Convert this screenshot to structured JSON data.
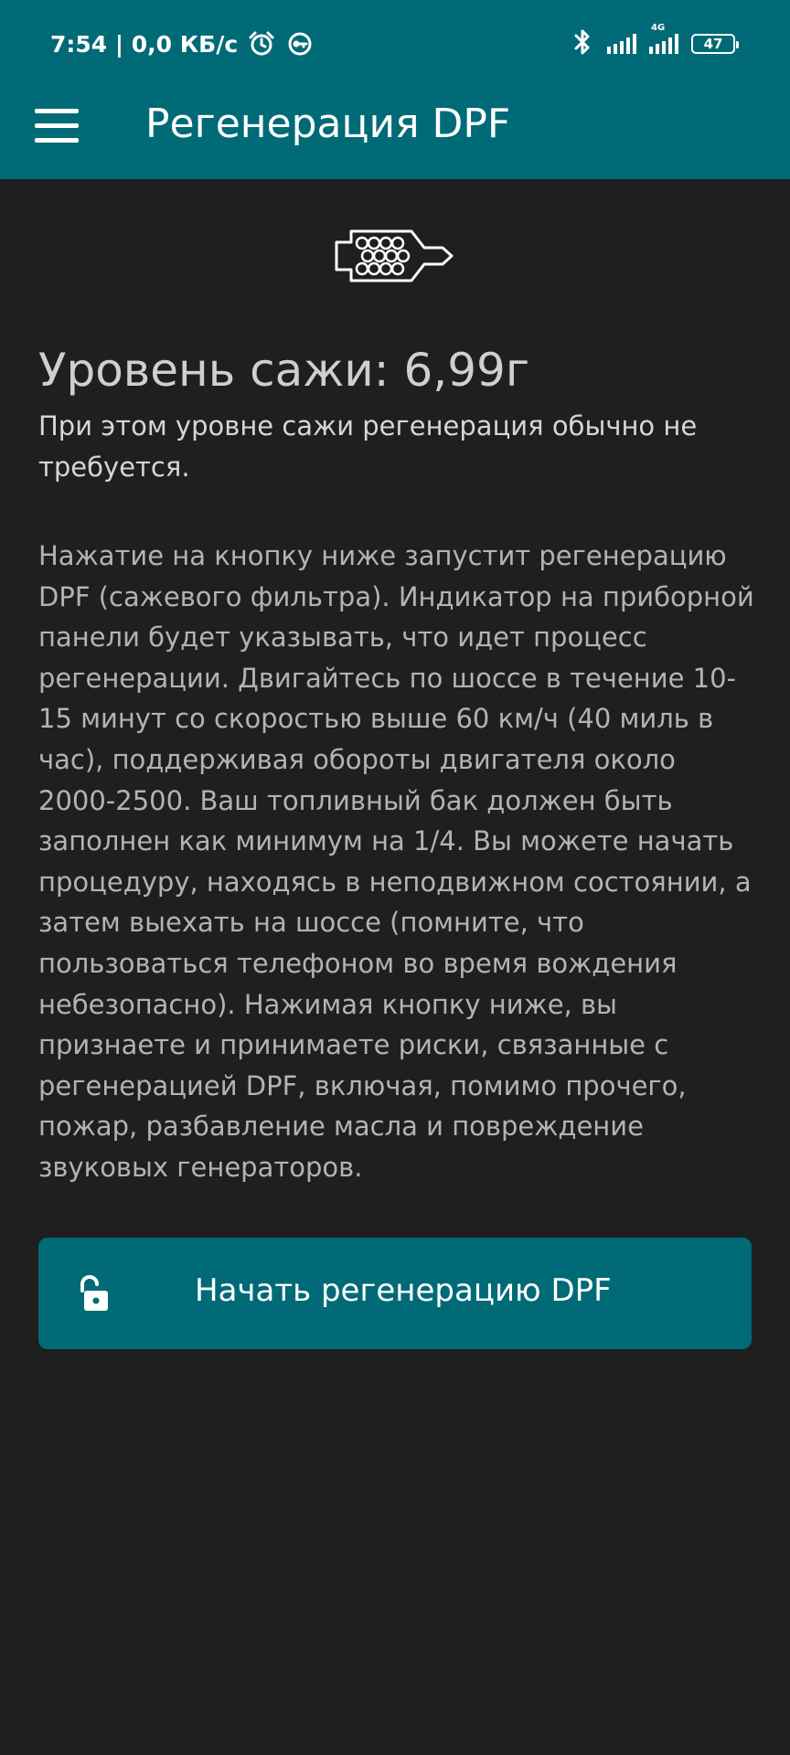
{
  "status_bar": {
    "time_speed": "7:54 | 0,0 КБ/с",
    "network_label": "4G",
    "battery_level": "47"
  },
  "app_bar": {
    "title": "Регенерация DPF"
  },
  "main": {
    "soot_level": "Уровень сажи: 6,99г",
    "soot_note": "При этом уровне сажи регенерация обычно не требуется.",
    "description": "Нажатие на кнопку ниже запустит регенерацию DPF (сажевого фильтра). Индикатор на приборной панели будет указывать, что идет процесс регенерации. Двигайтесь по шоссе в течение 10-15 минут со скоростью выше 60 км/ч (40 миль в час), поддерживая обороты двигателя около 2000-2500. Ваш топливный бак должен быть заполнен как минимум на 1/4. Вы можете начать процедуру, находясь в неподвижном состоянии, а затем выехать на шоссе (помните, что пользоваться телефоном во время вождения небезопасно). Нажимая кнопку ниже, вы признаете и принимаете риски, связанные с регенерацией DPF, включая, помимо прочего, пожар, разбавление масла и повреждение звуковых генераторов.",
    "start_button_label": "Начать регенерацию DPF"
  },
  "icons": {
    "menu": "hamburger-menu-icon",
    "dpf": "dpf-filter-icon",
    "lock": "unlocked-padlock-icon",
    "alarm": "alarm-clock-icon",
    "vpn": "vpn-key-icon",
    "bluetooth": "bluetooth-icon"
  },
  "colors": {
    "primary": "#006a77",
    "background": "#1f1f1f"
  }
}
